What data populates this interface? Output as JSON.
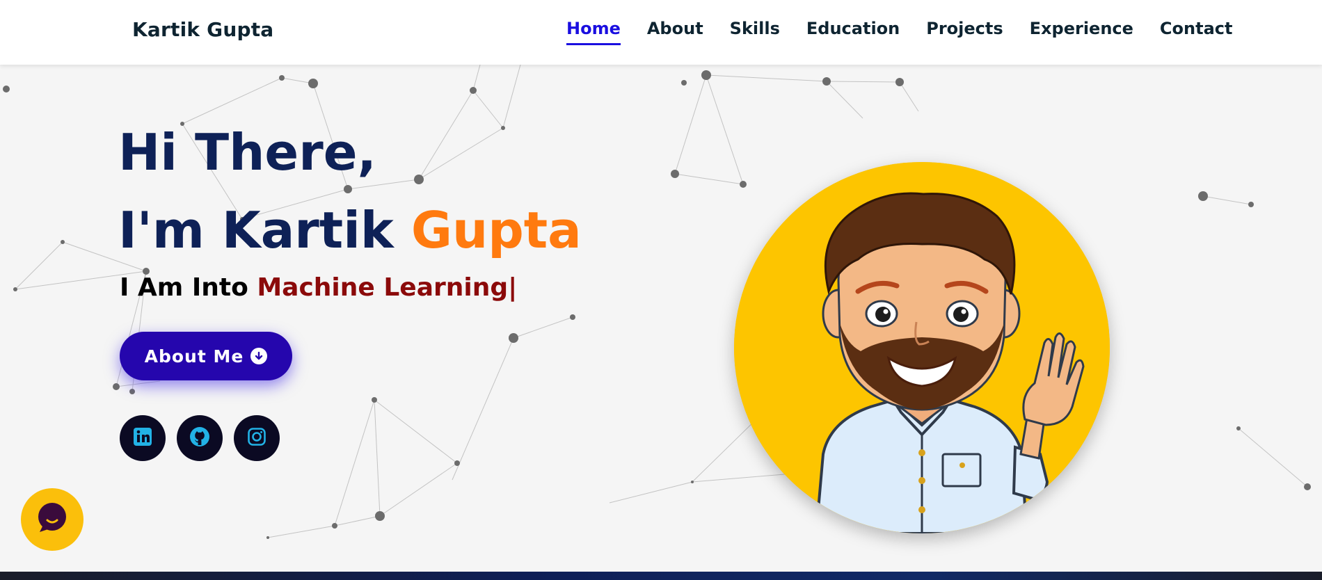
{
  "header": {
    "brand": "Kartik Gupta",
    "nav": [
      {
        "label": "Home",
        "active": true
      },
      {
        "label": "About"
      },
      {
        "label": "Skills"
      },
      {
        "label": "Education"
      },
      {
        "label": "Projects"
      },
      {
        "label": "Experience"
      },
      {
        "label": "Contact"
      }
    ]
  },
  "hero": {
    "greeting_line1": "Hi There,",
    "greeting_line2_prefix": "I'm Kartik ",
    "greeting_line2_accent": "Gupta",
    "typing_prefix": "I Am Into ",
    "typing_role": "Machine Learning|",
    "about_button_label": "About Me",
    "socials": [
      {
        "icon": "linkedin-icon"
      },
      {
        "icon": "github-icon"
      },
      {
        "icon": "instagram-icon"
      }
    ],
    "avatar": {
      "icon": "avatar-illustration",
      "background": "#fdc500"
    }
  },
  "chat_widget": {
    "icon": "chat-icon"
  },
  "colors": {
    "navy": "#0e2157",
    "accent_orange": "#ff7a0f",
    "role_red": "#8b0a0a",
    "active_nav": "#1a0ee0",
    "button": "#2506ad",
    "social_bg": "#0b0a23",
    "social_icon": "#22b2e6",
    "chat_bg": "#fbbf0b"
  }
}
